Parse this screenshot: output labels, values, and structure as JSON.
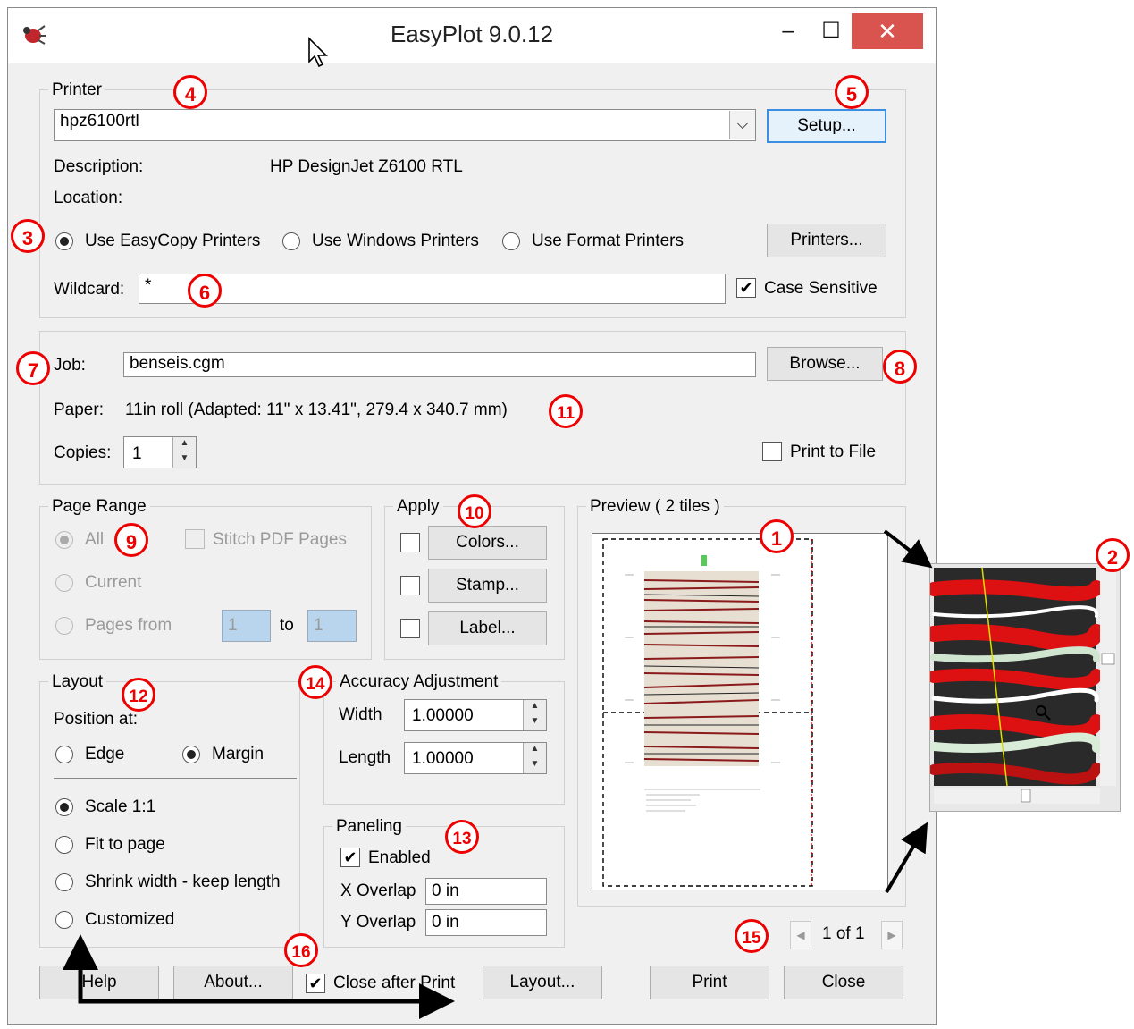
{
  "window": {
    "title": "EasyPlot 9.0.12",
    "minimize": "–",
    "maximize": "☐",
    "close": "✕"
  },
  "printer": {
    "group_label": "Printer",
    "selected": "hpz6100rtl",
    "setup_button": "Setup...",
    "description_label": "Description:",
    "description_value": "HP DesignJet Z6100 RTL",
    "location_label": "Location:",
    "radio_easycopy": "Use EasyCopy Printers",
    "radio_windows": "Use Windows Printers",
    "radio_format": "Use Format Printers",
    "printers_button": "Printers...",
    "wildcard_label": "Wildcard:",
    "wildcard_value": "*",
    "case_sensitive": "Case Sensitive"
  },
  "job": {
    "job_label": "Job:",
    "job_value": "benseis.cgm",
    "browse_button": "Browse...",
    "paper_label": "Paper:",
    "paper_value": "11in roll (Adapted: 11\" x 13.41\", 279.4 x 340.7 mm)",
    "copies_label": "Copies:",
    "copies_value": "1",
    "print_to_file": "Print to File"
  },
  "page_range": {
    "group_label": "Page Range",
    "all": "All",
    "stitch": "Stitch PDF Pages",
    "current": "Current",
    "pages_from": "Pages from",
    "from_value": "1",
    "to_label": "to",
    "to_value": "1"
  },
  "apply": {
    "group_label": "Apply",
    "colors": "Colors...",
    "stamp": "Stamp...",
    "label": "Label..."
  },
  "preview": {
    "group_label": "Preview ( 2 tiles )",
    "page_indicator": "1 of 1",
    "prev": "◀",
    "next": "▶"
  },
  "layout": {
    "group_label": "Layout",
    "position_at": "Position at:",
    "edge": "Edge",
    "margin": "Margin",
    "scale": "Scale 1:1",
    "fit": "Fit to page",
    "shrink": "Shrink width - keep length",
    "customized": "Customized"
  },
  "accuracy": {
    "group_label": "Accuracy Adjustment",
    "width_label": "Width",
    "width_value": "1.00000",
    "length_label": "Length",
    "length_value": "1.00000"
  },
  "paneling": {
    "group_label": "Paneling",
    "enabled": "Enabled",
    "x_label": "X Overlap",
    "x_value": "0 in",
    "y_label": "Y Overlap",
    "y_value": "0 in"
  },
  "bottom": {
    "help": "Help",
    "about": "About...",
    "close_after_print": "Close after Print",
    "layout": "Layout...",
    "print": "Print",
    "close": "Close"
  },
  "callouts": [
    "1",
    "2",
    "3",
    "4",
    "5",
    "6",
    "7",
    "8",
    "9",
    "10",
    "11",
    "12",
    "13",
    "14",
    "15",
    "16"
  ]
}
